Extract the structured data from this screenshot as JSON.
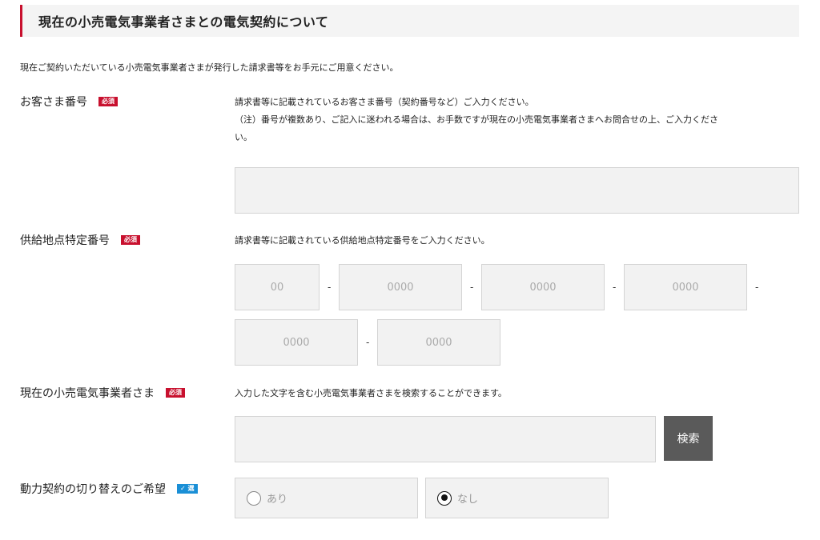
{
  "section": {
    "title": "現在の小売電気事業者さまとの電気契約について",
    "intro": "現在ご契約いただいている小売電気事業者さまが発行した請求書等をお手元にご用意ください。"
  },
  "badges": {
    "required": "必須",
    "optional": "✓ 選"
  },
  "customer_number": {
    "label": "お客さま番号",
    "help_line1": "請求書等に記載されているお客さま番号（契約番号など）ご入力ください。",
    "help_line2": "（注）番号が複数あり、ご記入に迷われる場合は、お手数ですが現在の小売電気事業者さまへお問合せの上、ご入力くださ",
    "help_line3": "い。",
    "value": ""
  },
  "supply_point": {
    "label": "供給地点特定番号",
    "help": "請求書等に記載されている供給地点特定番号をご入力ください。",
    "separator": "-",
    "segments": [
      {
        "placeholder": "00"
      },
      {
        "placeholder": "0000"
      },
      {
        "placeholder": "0000"
      },
      {
        "placeholder": "0000"
      },
      {
        "placeholder": "0000"
      },
      {
        "placeholder": "0000"
      }
    ]
  },
  "retailer": {
    "label": "現在の小売電気事業者さま",
    "help": "入力した文字を含む小売電気事業者さまを検索することができます。",
    "value": "",
    "search_button": "検索"
  },
  "power_contract": {
    "label": "動力契約の切り替えのご希望",
    "options": [
      {
        "label": "あり",
        "checked": false
      },
      {
        "label": "なし",
        "checked": true
      }
    ]
  }
}
